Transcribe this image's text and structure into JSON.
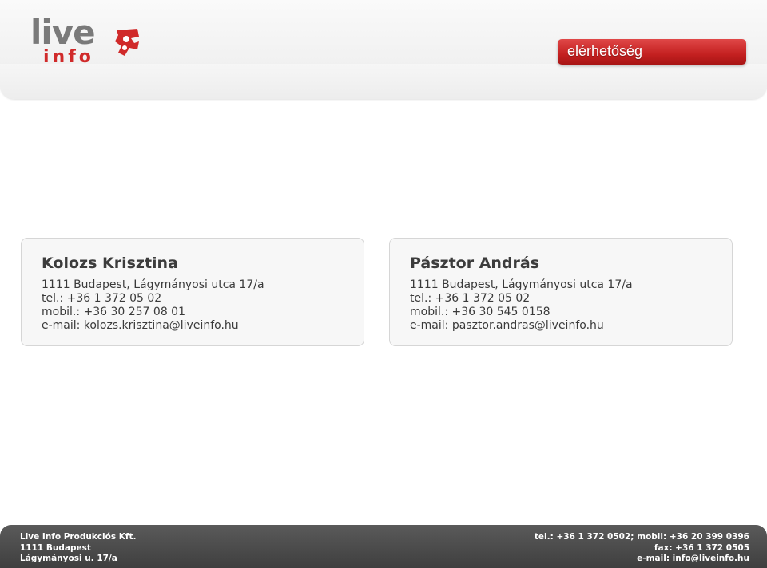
{
  "header": {
    "logo": {
      "top_text": "live",
      "bottom_text": "info",
      "accent_color": "#d02a2a",
      "icon": "logo-ampersand-mark"
    },
    "section_title": "elérhetőség"
  },
  "contacts": [
    {
      "name": "Kolozs Krisztina",
      "address": "1111 Budapest, Lágymányosi utca 17/a",
      "tel": "tel.: +36 1 372 05 02",
      "mobile": "mobil.: +36 30 257 08 01",
      "email": "e-mail:  kolozs.krisztina@liveinfo.hu"
    },
    {
      "name": "Pásztor András",
      "address": "1111 Budapest, Lágymányosi utca 17/a",
      "tel": "tel.: +36 1 372 05 02",
      "mobile": "mobil.: +36 30 545 0158",
      "email": "e-mail:  pasztor.andras@liveinfo.hu"
    }
  ],
  "footer": {
    "company": "Live Info Produkciós Kft.",
    "city": "1111 Budapest",
    "street": "Lágymányosi u. 17/a",
    "phones": "tel.: +36 1 372 0502; mobil: +36 20 399 0396",
    "fax": "fax: +36 1 372 0505",
    "email": "e-mail: info@liveinfo.hu"
  },
  "colors": {
    "badge": "#c42020",
    "footer": "#4a4a4a",
    "card_bg": "#f7f7f7"
  }
}
